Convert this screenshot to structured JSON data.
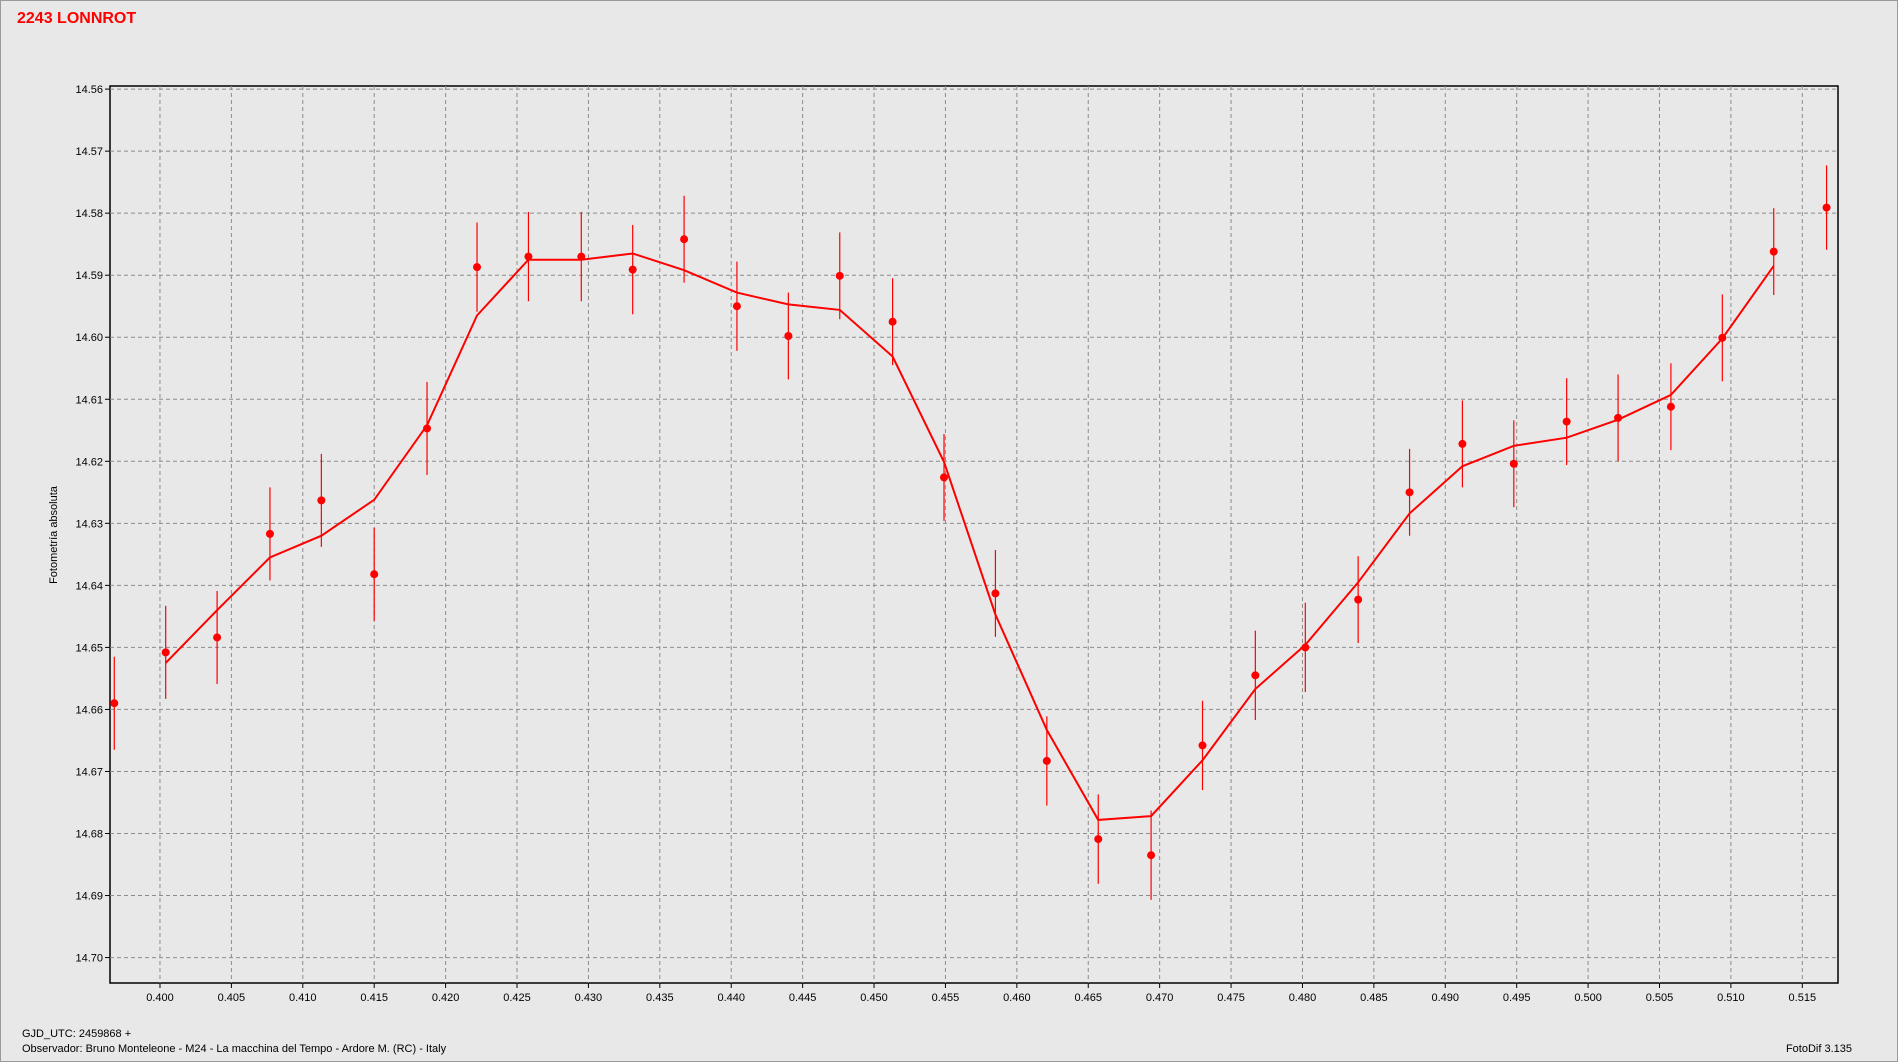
{
  "title": "2243 LONNROT",
  "footer": {
    "gjd_label": "GJD_UTC: 2459868 +",
    "observer": "Observador: Bruno Monteleone - M24 - La macchina del Tempo - Ardore M. (RC) - Italy",
    "software": "FotoDif 3.135"
  },
  "colors": {
    "series": "#ff0000",
    "grid": "#8c8c8c",
    "background": "#e8e8e8"
  },
  "chart_data": {
    "type": "scatter",
    "title": "2243 LONNROT",
    "xlabel": "",
    "ylabel": "Fotometría absoluta",
    "xlim": [
      0.3965,
      0.5175
    ],
    "ylim": [
      14.7041,
      14.5595
    ],
    "y_inverted": true,
    "grid": true,
    "x_ticks": [
      "0.400",
      "0.405",
      "0.410",
      "0.415",
      "0.420",
      "0.425",
      "0.430",
      "0.435",
      "0.440",
      "0.445",
      "0.450",
      "0.455",
      "0.460",
      "0.465",
      "0.470",
      "0.475",
      "0.480",
      "0.485",
      "0.490",
      "0.495",
      "0.500",
      "0.505",
      "0.510",
      "0.515"
    ],
    "y_ticks": [
      "14.56",
      "14.57",
      "14.58",
      "14.59",
      "14.60",
      "14.61",
      "14.62",
      "14.63",
      "14.64",
      "14.65",
      "14.66",
      "14.67",
      "14.68",
      "14.69",
      "14.70"
    ],
    "points": {
      "x": [
        0.3968,
        0.4004,
        0.404,
        0.4077,
        0.4113,
        0.415,
        0.4187,
        0.4222,
        0.4258,
        0.4295,
        0.4331,
        0.4367,
        0.4404,
        0.444,
        0.4476,
        0.4513,
        0.4549,
        0.4585,
        0.4621,
        0.4657,
        0.4694,
        0.473,
        0.4767,
        0.4802,
        0.4839,
        0.4875,
        0.4912,
        0.4948,
        0.4985,
        0.5021,
        0.5058,
        0.5094,
        0.513,
        0.5167
      ],
      "y": [
        14.659,
        14.6508,
        14.6484,
        14.6317,
        14.6263,
        14.6382,
        14.6147,
        14.5887,
        14.587,
        14.587,
        14.5891,
        14.5842,
        14.595,
        14.5998,
        14.5901,
        14.5975,
        14.6226,
        14.6413,
        14.6683,
        14.6809,
        14.6835,
        14.6658,
        14.6545,
        14.65,
        14.6423,
        14.625,
        14.6172,
        14.6204,
        14.6136,
        14.613,
        14.6112,
        14.6001,
        14.5862,
        14.5791
      ],
      "err": [
        0.0075,
        0.0075,
        0.0075,
        0.0075,
        0.0075,
        0.0075,
        0.0075,
        0.0072,
        0.0072,
        0.0072,
        0.0072,
        0.007,
        0.0072,
        0.007,
        0.007,
        0.007,
        0.007,
        0.007,
        0.0072,
        0.0072,
        0.0072,
        0.0072,
        0.0072,
        0.0072,
        0.007,
        0.007,
        0.007,
        0.007,
        0.007,
        0.007,
        0.007,
        0.007,
        0.007,
        0.0068
      ]
    },
    "smooth_line": {
      "x": [
        0.4004,
        0.404,
        0.4077,
        0.4113,
        0.415,
        0.4187,
        0.4222,
        0.4258,
        0.4295,
        0.4331,
        0.4367,
        0.4404,
        0.444,
        0.4476,
        0.4513,
        0.4549,
        0.4585,
        0.4621,
        0.4657,
        0.4694,
        0.473,
        0.4767,
        0.4802,
        0.4839,
        0.4875,
        0.4912,
        0.4948,
        0.4985,
        0.5021,
        0.5058,
        0.5094,
        0.513
      ],
      "y": [
        14.6525,
        14.644,
        14.6355,
        14.632,
        14.6262,
        14.6142,
        14.5965,
        14.5875,
        14.5875,
        14.5865,
        14.5892,
        14.5928,
        14.5947,
        14.5956,
        14.6031,
        14.6201,
        14.6447,
        14.6633,
        14.6778,
        14.6772,
        14.6682,
        14.6567,
        14.6496,
        14.6395,
        14.6284,
        14.6208,
        14.6175,
        14.6162,
        14.6133,
        14.6093,
        14.6002,
        14.5885
      ]
    }
  }
}
